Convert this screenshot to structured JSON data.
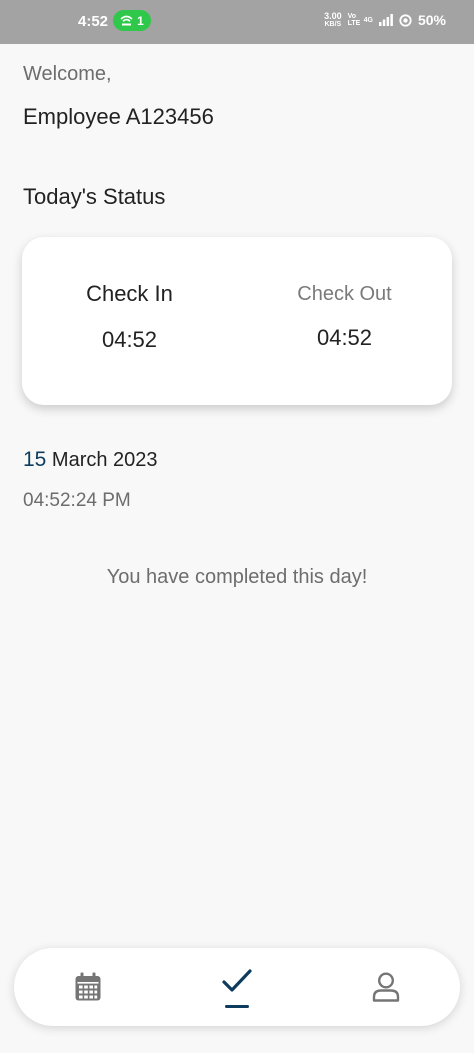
{
  "status_bar": {
    "time": "4:52",
    "hotspot_count": "1",
    "net_speed_value": "3.00",
    "net_speed_unit": "KB/S",
    "volte": "Vo LTE",
    "network": "4G",
    "battery": "50%"
  },
  "header": {
    "welcome": "Welcome,",
    "employee_name": "Employee A123456"
  },
  "status_section": {
    "title": "Today's Status",
    "check_in_label": "Check In",
    "check_in_time": "04:52",
    "check_out_label": "Check Out",
    "check_out_time": "04:52"
  },
  "date_info": {
    "day": "15",
    "month_year": "March 2023",
    "time": "04:52:24 PM"
  },
  "message": "You have completed this day!",
  "nav": {
    "items": [
      {
        "icon": "calendar-icon"
      },
      {
        "icon": "check-icon",
        "active": true
      },
      {
        "icon": "user-icon"
      }
    ],
    "active_color": "#0d3c5e",
    "inactive_color": "#757575"
  }
}
